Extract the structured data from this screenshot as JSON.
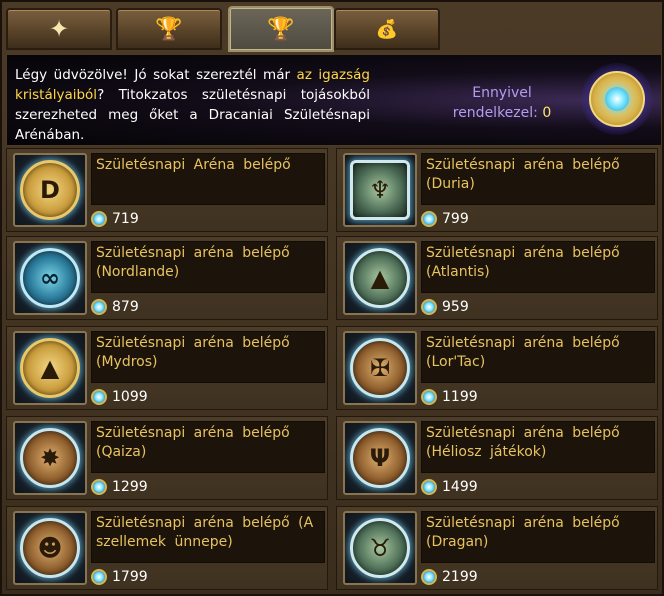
{
  "tabs": [
    {
      "icon": "sparkle-star-icon",
      "glyph": "✦",
      "active": false
    },
    {
      "icon": "trophy-icon",
      "glyph": "🏆",
      "active": false
    },
    {
      "icon": "arena-trophy-icon",
      "glyph": "🏆",
      "active": true
    },
    {
      "icon": "money-bag-icon",
      "glyph": "💰",
      "active": false
    }
  ],
  "banner": {
    "text_before": "Légy üdvözölve! Jó sokat szereztél már ",
    "highlight": "az igazság kristályaiból",
    "text_after": "? Titokzatos születésnapi tojásokból szerezheted meg őket a Dracaniai Születésnapi Arénában.",
    "have_label": "Ennyivel rendelkezel:",
    "have_value": "0"
  },
  "items": [
    {
      "name": "Születésnapi Aréna belépő",
      "price": "719",
      "icon": "dracania-emblem-icon",
      "style": "gold",
      "glyph": "D"
    },
    {
      "name": "Születésnapi aréna belépő (Duria)",
      "price": "799",
      "icon": "duria-emblem-icon",
      "style": "green square",
      "glyph": "♆"
    },
    {
      "name": "Születésnapi aréna belépő (Nordlande)",
      "price": "879",
      "icon": "nordlande-emblem-icon",
      "style": "blue",
      "glyph": "∞"
    },
    {
      "name": "Születésnapi aréna belépő (Atlantis)",
      "price": "959",
      "icon": "atlantis-emblem-icon",
      "style": "green",
      "glyph": "▲"
    },
    {
      "name": "Születésnapi aréna belépő (Mydros)",
      "price": "1099",
      "icon": "mydros-emblem-icon",
      "style": "gold",
      "glyph": "▲"
    },
    {
      "name": "Születésnapi aréna belépő (Lor'Tac)",
      "price": "1199",
      "icon": "lortac-emblem-icon",
      "style": "bronze",
      "glyph": "✠"
    },
    {
      "name": "Születésnapi aréna belépő (Qaiza)",
      "price": "1299",
      "icon": "qaiza-emblem-icon",
      "style": "bronze",
      "glyph": "✸"
    },
    {
      "name": "Születésnapi aréna belépő (Héliosz játékok)",
      "price": "1499",
      "icon": "helios-emblem-icon",
      "style": "bronze",
      "glyph": "Ψ"
    },
    {
      "name": "Születésnapi aréna belépő (A szellemek ünnepe)",
      "price": "1799",
      "icon": "pumpkin-emblem-icon",
      "style": "bronze",
      "glyph": "☻"
    },
    {
      "name": "Születésnapi aréna belépő (Dragan)",
      "price": "2199",
      "icon": "dragan-emblem-icon",
      "style": "green",
      "glyph": "♉"
    }
  ]
}
